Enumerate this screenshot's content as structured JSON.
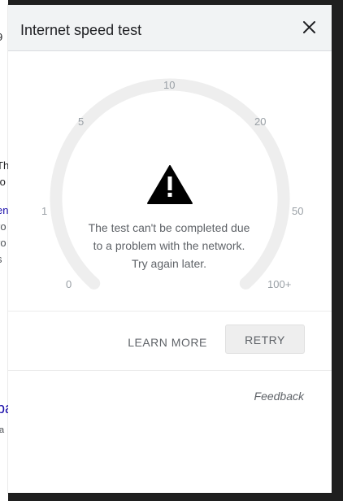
{
  "dialog": {
    "title": "Internet speed test",
    "close_icon": "close-icon"
  },
  "gauge": {
    "ticks": [
      "0",
      "1",
      "5",
      "10",
      "20",
      "50",
      "100+"
    ],
    "error_icon": "warning-icon",
    "message": "The test can't be completed due to a problem with the network. Try again later."
  },
  "actions": {
    "learn_more": "LEARN MORE",
    "retry": "RETRY"
  },
  "footer": {
    "feedback": "Feedback"
  },
  "colors": {
    "header_bg": "#f1f3f4",
    "gauge_track": "#eeeeee",
    "text_secondary": "#5f6368",
    "warning_icon": "#000000"
  }
}
